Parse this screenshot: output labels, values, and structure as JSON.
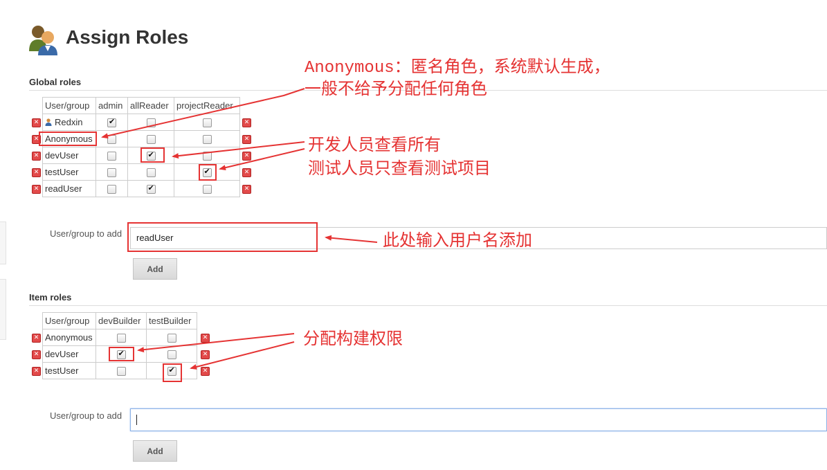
{
  "page": {
    "title": "Assign Roles"
  },
  "global": {
    "section_title": "Global roles",
    "columns": [
      "User/group",
      "admin",
      "allReader",
      "projectReader"
    ],
    "rows": [
      {
        "user": "Redxin",
        "icon": "user-icon",
        "checks": [
          true,
          false,
          false
        ]
      },
      {
        "user": "Anonymous",
        "checks": [
          false,
          false,
          false
        ]
      },
      {
        "user": "devUser",
        "checks": [
          false,
          true,
          false
        ]
      },
      {
        "user": "testUser",
        "checks": [
          false,
          false,
          true
        ]
      },
      {
        "user": "readUser",
        "checks": [
          false,
          true,
          false
        ]
      }
    ],
    "add_label": "User/group to add",
    "add_value": "readUser",
    "add_button": "Add"
  },
  "item": {
    "section_title": "Item roles",
    "columns": [
      "User/group",
      "devBuilder",
      "testBuilder"
    ],
    "rows": [
      {
        "user": "Anonymous",
        "checks": [
          false,
          false
        ]
      },
      {
        "user": "devUser",
        "checks": [
          true,
          false
        ]
      },
      {
        "user": "testUser",
        "checks": [
          false,
          true
        ]
      }
    ],
    "add_label": "User/group to add",
    "add_value": "",
    "add_button": "Add"
  },
  "annotations": {
    "anonymous_line1": "Anonymous：匿名角色，系统默认生成，",
    "anonymous_line2": "一般不给予分配任何角色",
    "dev_line": "开发人员查看所有",
    "test_line": "测试人员只查看测试项目",
    "input_note": "此处输入用户名添加",
    "build_note": "分配构建权限",
    "color": "#e53333"
  }
}
